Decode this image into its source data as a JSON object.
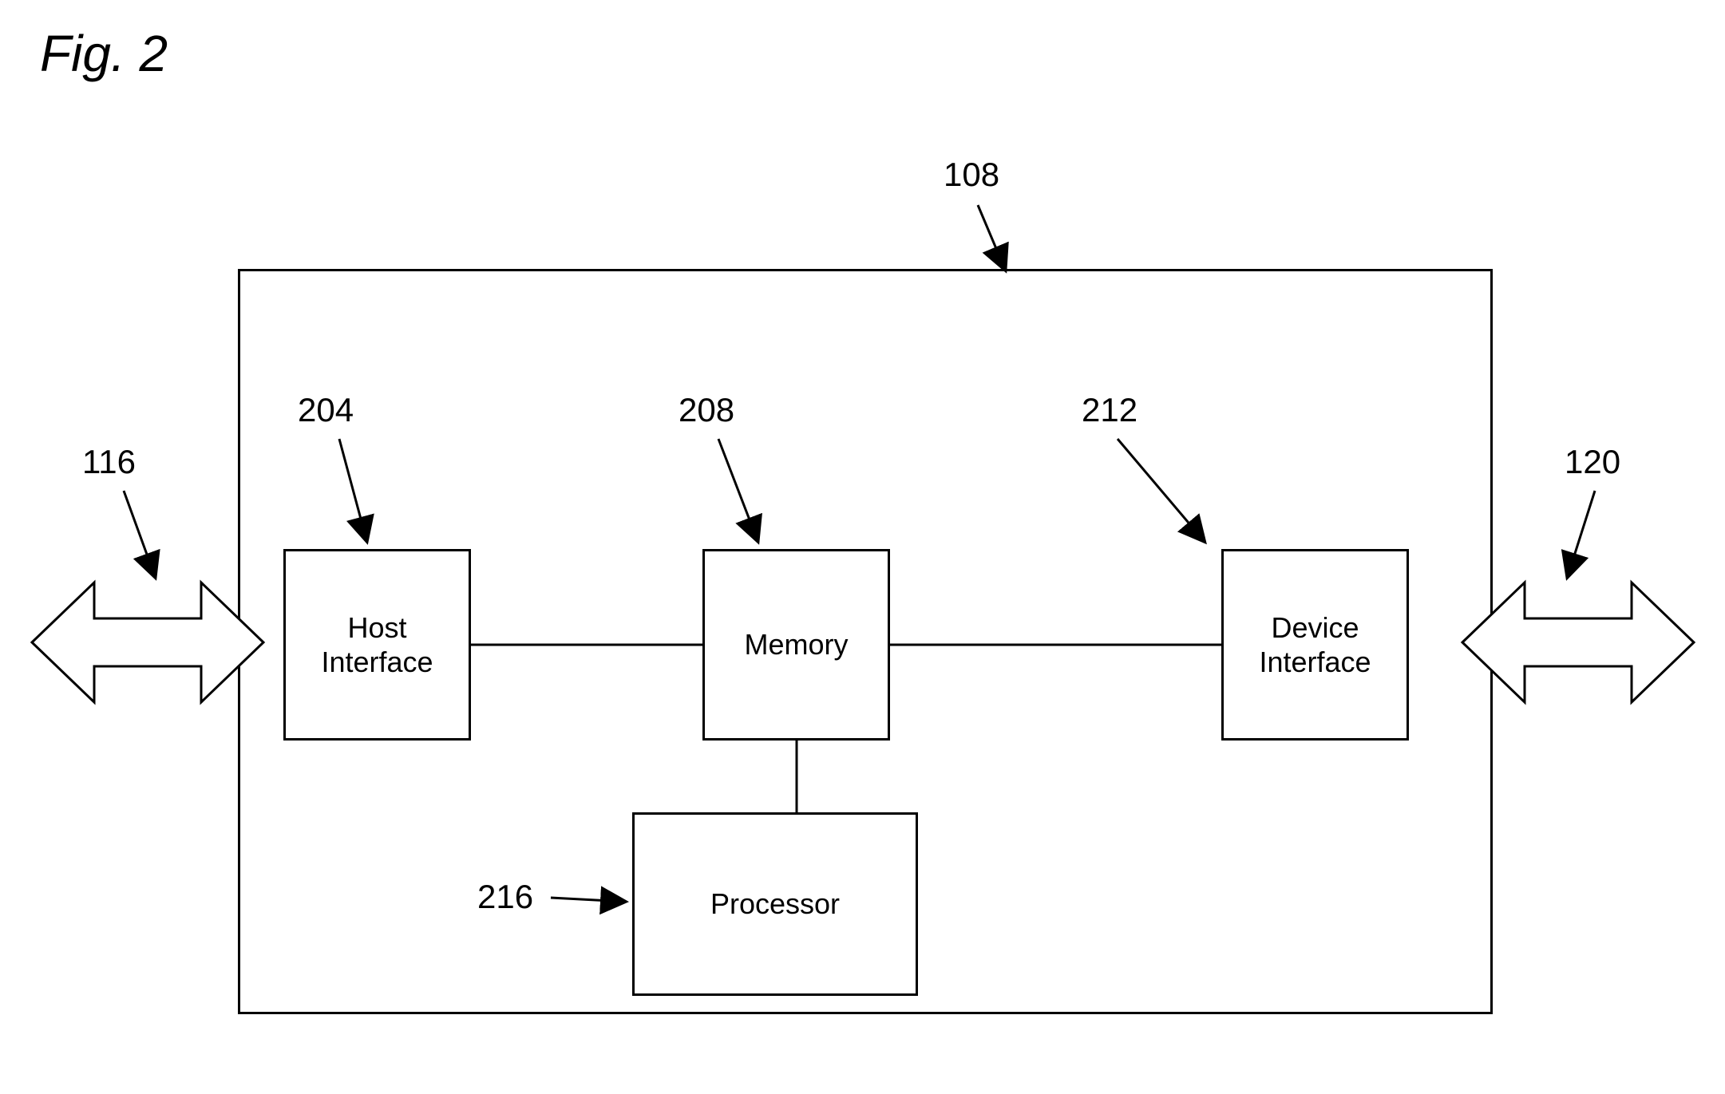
{
  "figure_title": "Fig. 2",
  "container_ref": "108",
  "arrow_left_ref": "116",
  "arrow_right_ref": "120",
  "blocks": {
    "host_interface": {
      "ref": "204",
      "line1": "Host",
      "line2": "Interface"
    },
    "memory": {
      "ref": "208",
      "line1": "Memory",
      "line2": ""
    },
    "device_interface": {
      "ref": "212",
      "line1": "Device",
      "line2": "Interface"
    },
    "processor": {
      "ref": "216",
      "line1": "Processor",
      "line2": ""
    }
  }
}
